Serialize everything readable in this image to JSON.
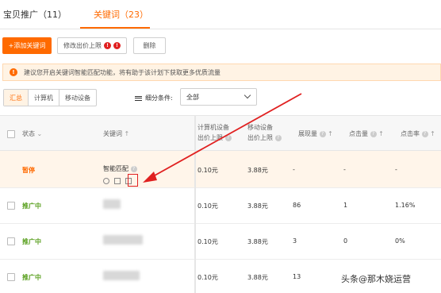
{
  "tabs": [
    {
      "label": "宝贝推广（11）"
    },
    {
      "label": "关键词（23）"
    }
  ],
  "toolbar": {
    "add_keyword": "+添加关键词",
    "modify_bid": "修改出价上限",
    "badge_1": "!",
    "badge_2": "!",
    "delete": "删除"
  },
  "notice": {
    "icon": "!",
    "text": "建议您开启关键词智能匹配功能，将有助于该计划下获取更多优质流量"
  },
  "device_tabs": [
    {
      "label": "汇总"
    },
    {
      "label": "计算机"
    },
    {
      "label": "移动设备"
    }
  ],
  "filter": {
    "label": "细分条件:",
    "value": "全部"
  },
  "table": {
    "headers": {
      "status": "状态",
      "keyword": "关键词",
      "pc_bid_l1": "计算机设备",
      "pc_bid_l2": "出价上限",
      "mobile_bid_l1": "移动设备",
      "mobile_bid_l2": "出价上限",
      "impressions": "展现量",
      "clicks": "点击量",
      "ctr": "点击率"
    },
    "rows": [
      {
        "status": "暂停",
        "keyword": "智能匹配",
        "pc_bid": "0.10元",
        "mobile_bid": "3.88元",
        "impressions": "-",
        "clicks": "-",
        "ctr": "-"
      },
      {
        "status": "推广中",
        "keyword": "",
        "pc_bid": "0.10元",
        "mobile_bid": "3.88元",
        "impressions": "86",
        "clicks": "1",
        "ctr": "1.16%"
      },
      {
        "status": "推广中",
        "keyword": "",
        "pc_bid": "0.10元",
        "mobile_bid": "3.88元",
        "impressions": "3",
        "clicks": "0",
        "ctr": "0%"
      },
      {
        "status": "推广中",
        "keyword": "",
        "pc_bid": "0.10元",
        "mobile_bid": "3.88元",
        "impressions": "13",
        "clicks": "",
        "ctr": ""
      }
    ]
  },
  "watermark": "头条@那木娆运营",
  "colors": {
    "accent": "#ff6a00",
    "active_status": "#5aa020",
    "annotation": "#e02020"
  }
}
